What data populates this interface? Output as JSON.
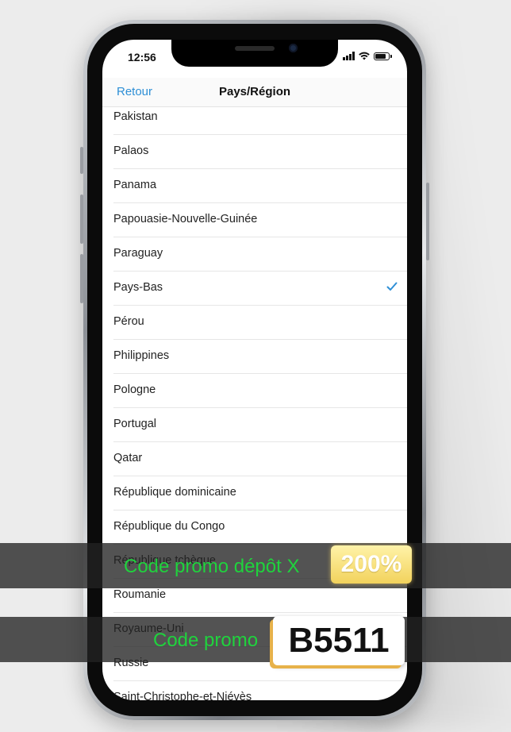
{
  "status_bar": {
    "time": "12:56"
  },
  "nav": {
    "back_label": "Retour",
    "title": "Pays/Région"
  },
  "countries": [
    {
      "label": "Pakistan",
      "selected": false
    },
    {
      "label": "Palaos",
      "selected": false
    },
    {
      "label": "Panama",
      "selected": false
    },
    {
      "label": "Papouasie-Nouvelle-Guinée",
      "selected": false
    },
    {
      "label": "Paraguay",
      "selected": false
    },
    {
      "label": "Pays-Bas",
      "selected": true
    },
    {
      "label": "Pérou",
      "selected": false
    },
    {
      "label": "Philippines",
      "selected": false
    },
    {
      "label": "Pologne",
      "selected": false
    },
    {
      "label": "Portugal",
      "selected": false
    },
    {
      "label": "Qatar",
      "selected": false
    },
    {
      "label": "République dominicaine",
      "selected": false
    },
    {
      "label": "République du Congo",
      "selected": false
    },
    {
      "label": "République tchèque",
      "selected": false
    },
    {
      "label": "Roumanie",
      "selected": false
    },
    {
      "label": "Royaume-Uni",
      "selected": false
    },
    {
      "label": "Russie",
      "selected": false
    },
    {
      "label": "Saint-Christophe-et-Niévès",
      "selected": false
    }
  ],
  "overlay": {
    "promo_line1": "Code promo dépôt X",
    "badge_percent": "200%",
    "promo_line2": "Code promo",
    "badge_code": "B5511"
  },
  "colors": {
    "accent": "#2e8fd6",
    "promo_text": "#1fd33d",
    "badge_yellow": "#f2d25c"
  }
}
